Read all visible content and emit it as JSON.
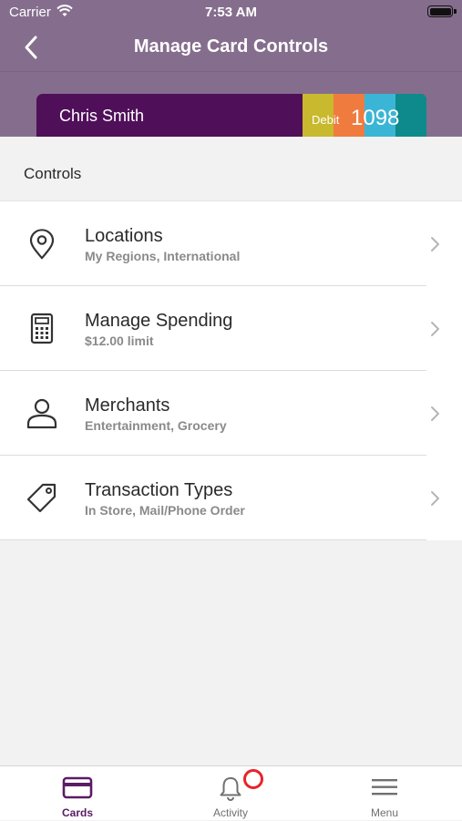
{
  "status_bar": {
    "carrier": "Carrier",
    "time": "7:53 AM"
  },
  "nav": {
    "title": "Manage Card Controls"
  },
  "card": {
    "name": "Chris Smith",
    "type": "Debit",
    "last4": "1098",
    "colors": {
      "base": "#4f0f59",
      "stripes": [
        "#c8b92e",
        "#f07b3f",
        "#3bb5d6",
        "#0f8a8c"
      ]
    }
  },
  "section": {
    "title": "Controls"
  },
  "controls": [
    {
      "title": "Locations",
      "subtitle": "My Regions, International",
      "icon": "location-pin-icon"
    },
    {
      "title": "Manage Spending",
      "subtitle": "$12.00 limit",
      "icon": "calculator-icon"
    },
    {
      "title": "Merchants",
      "subtitle": "Entertainment, Grocery",
      "icon": "person-icon"
    },
    {
      "title": "Transaction Types",
      "subtitle": "In Store, Mail/Phone Order",
      "icon": "tag-icon"
    }
  ],
  "tabbar": {
    "tabs": [
      {
        "label": "Cards",
        "icon": "card-icon",
        "active": true
      },
      {
        "label": "Activity",
        "icon": "bell-icon",
        "active": false
      },
      {
        "label": "Menu",
        "icon": "menu-icon",
        "active": false
      }
    ]
  },
  "colors": {
    "header": "#856e8d",
    "accent": "#5b1b66",
    "badge": "#e8232a"
  }
}
